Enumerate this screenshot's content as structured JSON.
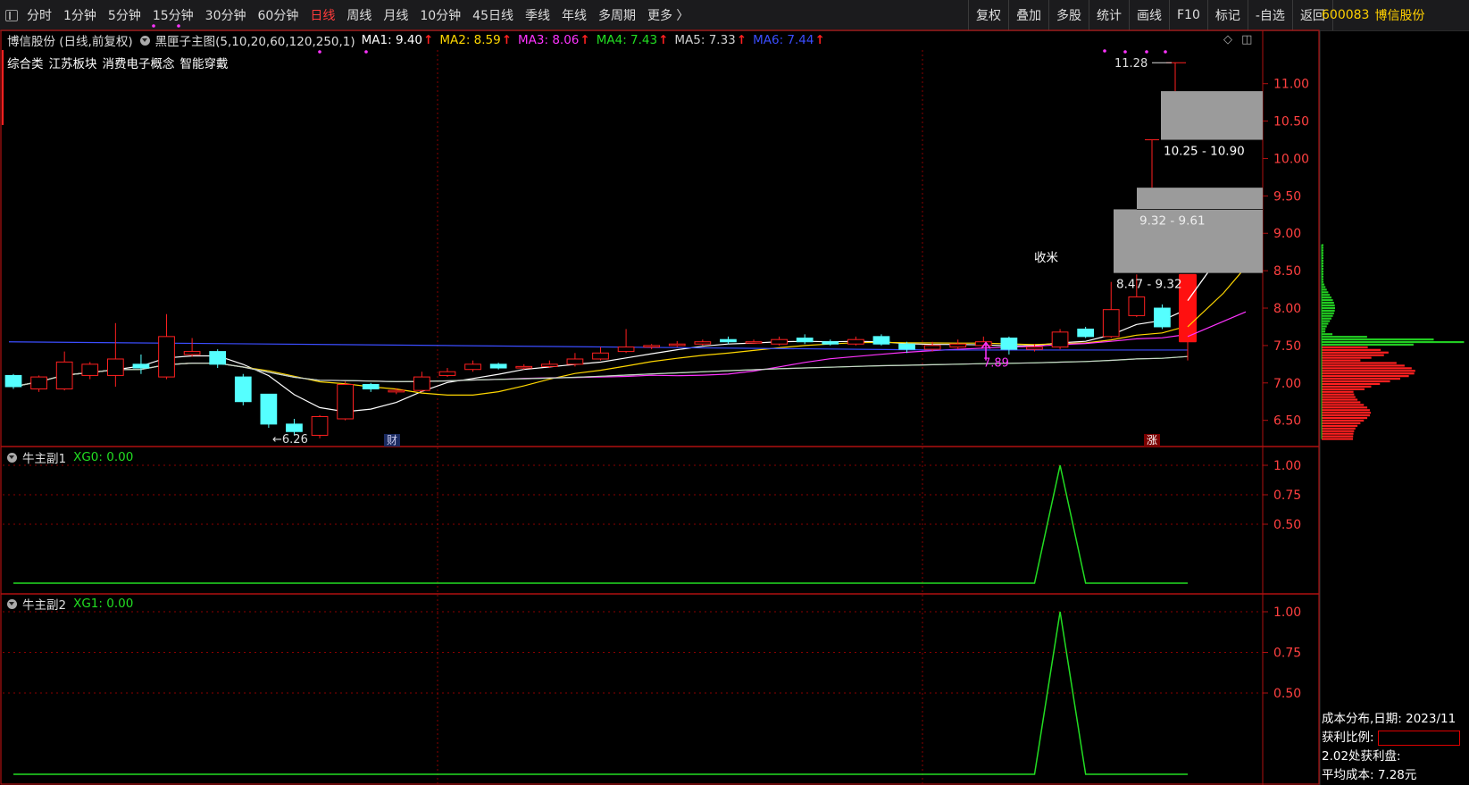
{
  "toolbar": {
    "periods": [
      "分时",
      "1分钟",
      "5分钟",
      "15分钟",
      "30分钟",
      "60分钟",
      "日线",
      "周线",
      "月线",
      "10分钟",
      "45日线",
      "季线",
      "年线",
      "多周期",
      "更多 〉"
    ],
    "active_period": "日线",
    "tools": [
      "复权",
      "叠加",
      "多股",
      "统计",
      "画线",
      "F10",
      "标记",
      "-自选",
      "返回"
    ],
    "stock_code": "600083",
    "stock_name": "博信股份"
  },
  "main_header": {
    "stock_label": "博信股份 (日线,前复权)",
    "indicator": "黑匣子主图(5,10,20,60,120,250,1)",
    "ma": [
      {
        "label": "MA1: 9.40",
        "color": "#ffffff"
      },
      {
        "label": "MA2: 8.59",
        "color": "#ffd700"
      },
      {
        "label": "MA3: 8.06",
        "color": "#ff33ff"
      },
      {
        "label": "MA4: 7.43",
        "color": "#22dd22"
      },
      {
        "label": "MA5: 7.33",
        "color": "#d0d0d0"
      },
      {
        "label": "MA6: 7.44",
        "color": "#3b4dff"
      }
    ],
    "concepts": [
      "综合类",
      "江苏板块",
      "消费电子概念",
      "智能穿戴"
    ]
  },
  "annotations": {
    "high": "11.28",
    "low": "6.26",
    "mark_price": "7.89",
    "shoumi": "收米",
    "cai": "财",
    "zhang": "涨",
    "zone1": "10.25 - 10.90",
    "zone2": "9.32 - 9.61",
    "zone3": "8.47 - 9.32"
  },
  "price_axis": [
    "11.00",
    "10.50",
    "10.00",
    "9.50",
    "9.00",
    "8.50",
    "8.00",
    "7.50",
    "7.00",
    "6.50"
  ],
  "sub1": {
    "name": "牛主副1",
    "value": "XG0: 0.00",
    "axis": [
      "1.00",
      "0.75",
      "0.50"
    ]
  },
  "sub2": {
    "name": "牛主副2",
    "value": "XG1: 0.00",
    "axis": [
      "1.00",
      "0.75",
      "0.50"
    ]
  },
  "cost": {
    "title": "成本分布,日期: 2023/11",
    "ratio_label": "获利比例:",
    "profit": "2.02处获利盘:",
    "avg_cost": "平均成本: 7.28元"
  },
  "colors": {
    "up": "#ff2020",
    "down": "#55ffff",
    "grid": "#8b0000",
    "frame": "#b01010"
  },
  "chart_data": {
    "type": "candlestick",
    "candles": [
      [
        7.1,
        6.95,
        7.12,
        6.92
      ],
      [
        6.92,
        7.08,
        7.1,
        6.88
      ],
      [
        6.92,
        7.28,
        7.42,
        6.9
      ],
      [
        7.1,
        7.25,
        7.28,
        7.05
      ],
      [
        7.1,
        7.32,
        7.8,
        6.95
      ],
      [
        7.25,
        7.2,
        7.38,
        7.12
      ],
      [
        7.08,
        7.62,
        7.92,
        7.05
      ],
      [
        7.38,
        7.42,
        7.6,
        7.35
      ],
      [
        7.42,
        7.25,
        7.45,
        7.2
      ],
      [
        7.08,
        6.75,
        7.12,
        6.7
      ],
      [
        6.85,
        6.45,
        6.85,
        6.4
      ],
      [
        6.45,
        6.35,
        6.52,
        6.3
      ],
      [
        6.3,
        6.55,
        6.57,
        6.26
      ],
      [
        6.52,
        6.98,
        7.02,
        6.5
      ],
      [
        6.98,
        6.92,
        7.0,
        6.88
      ],
      [
        6.88,
        6.9,
        6.93,
        6.85
      ],
      [
        6.9,
        7.08,
        7.15,
        6.88
      ],
      [
        7.1,
        7.15,
        7.2,
        7.08
      ],
      [
        7.18,
        7.25,
        7.3,
        7.15
      ],
      [
        7.25,
        7.2,
        7.27,
        7.18
      ],
      [
        7.2,
        7.22,
        7.25,
        7.18
      ],
      [
        7.22,
        7.25,
        7.3,
        7.2
      ],
      [
        7.25,
        7.32,
        7.4,
        7.22
      ],
      [
        7.32,
        7.4,
        7.48,
        7.3
      ],
      [
        7.42,
        7.48,
        7.72,
        7.4
      ],
      [
        7.48,
        7.5,
        7.52,
        7.45
      ],
      [
        7.5,
        7.52,
        7.56,
        7.48
      ],
      [
        7.52,
        7.55,
        7.58,
        7.5
      ],
      [
        7.58,
        7.55,
        7.62,
        7.52
      ],
      [
        7.55,
        7.55,
        7.58,
        7.52
      ],
      [
        7.52,
        7.58,
        7.62,
        7.5
      ],
      [
        7.6,
        7.55,
        7.65,
        7.52
      ],
      [
        7.55,
        7.52,
        7.58,
        7.5
      ],
      [
        7.52,
        7.58,
        7.62,
        7.5
      ],
      [
        7.62,
        7.52,
        7.65,
        7.5
      ],
      [
        7.52,
        7.45,
        7.55,
        7.4
      ],
      [
        7.45,
        7.5,
        7.55,
        7.42
      ],
      [
        7.48,
        7.52,
        7.58,
        7.45
      ],
      [
        7.5,
        7.55,
        7.62,
        7.48
      ],
      [
        7.6,
        7.45,
        7.62,
        7.38
      ],
      [
        7.45,
        7.48,
        7.52,
        7.42
      ],
      [
        7.48,
        7.68,
        7.72,
        7.45
      ],
      [
        7.72,
        7.62,
        7.75,
        7.6
      ],
      [
        7.62,
        7.98,
        8.35,
        7.6
      ],
      [
        7.9,
        8.15,
        8.45,
        7.88
      ],
      [
        8.0,
        7.75,
        8.05,
        7.72
      ],
      [
        7.55,
        8.45,
        8.45,
        7.3
      ]
    ],
    "ylim": [
      6.15,
      11.45
    ],
    "sub_series": [
      0,
      0,
      0,
      0,
      0,
      0,
      0,
      0,
      0,
      0,
      0,
      0,
      0,
      0,
      0,
      0,
      0,
      0,
      0,
      0,
      0,
      0,
      0,
      0,
      0,
      0,
      0,
      0,
      0,
      0,
      0,
      0,
      0,
      0,
      0,
      0,
      0,
      0,
      0,
      0,
      0,
      1,
      0,
      0,
      0,
      0,
      0
    ],
    "sub_ylim": [
      0,
      1.0
    ]
  }
}
